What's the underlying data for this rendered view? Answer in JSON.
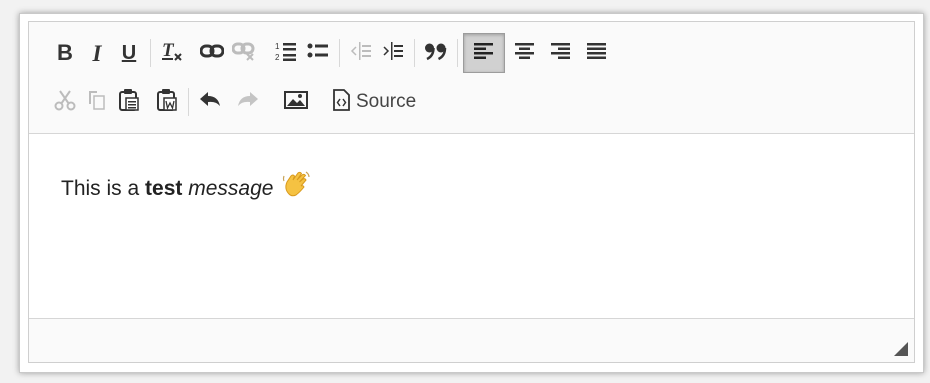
{
  "toolbar": {
    "row1": [
      {
        "name": "bold-button",
        "icon": "bold-icon",
        "text": "B"
      },
      {
        "name": "italic-button",
        "icon": "italic-icon",
        "text": "I"
      },
      {
        "name": "underline-button",
        "icon": "underline-icon",
        "text": "U"
      },
      {
        "name": "remove-format-button",
        "icon": "remove-format-icon",
        "text": "Tx"
      },
      {
        "name": "link-button",
        "icon": "link-icon"
      },
      {
        "name": "unlink-button",
        "icon": "unlink-icon",
        "disabled": true
      },
      {
        "name": "numbered-list-button",
        "icon": "numbered-list-icon"
      },
      {
        "name": "bulleted-list-button",
        "icon": "bulleted-list-icon"
      },
      {
        "name": "outdent-button",
        "icon": "outdent-icon",
        "disabled": true
      },
      {
        "name": "indent-button",
        "icon": "indent-icon"
      },
      {
        "name": "blockquote-button",
        "icon": "blockquote-icon"
      },
      {
        "name": "align-left-button",
        "icon": "align-left-icon",
        "active": true
      },
      {
        "name": "align-center-button",
        "icon": "align-center-icon"
      },
      {
        "name": "align-right-button",
        "icon": "align-right-icon"
      },
      {
        "name": "align-justify-button",
        "icon": "align-justify-icon"
      }
    ],
    "row2": [
      {
        "name": "cut-button",
        "icon": "cut-icon",
        "disabled": true
      },
      {
        "name": "copy-button",
        "icon": "copy-icon",
        "disabled": true
      },
      {
        "name": "paste-button",
        "icon": "paste-icon"
      },
      {
        "name": "paste-from-word-button",
        "icon": "paste-from-word-icon"
      },
      {
        "name": "undo-button",
        "icon": "undo-icon"
      },
      {
        "name": "redo-button",
        "icon": "redo-icon",
        "disabled": true
      },
      {
        "name": "image-button",
        "icon": "image-icon"
      }
    ],
    "source_label": "Source"
  },
  "content": {
    "prefix": "This is a ",
    "bold": "test",
    "italic": "message",
    "emoji": "waving-hand-icon"
  },
  "colors": {
    "active_bg": "#d1d1d1",
    "toolbar_bg": "#fafafa",
    "icon": "#333333",
    "icon_disabled": "#b8b8b8"
  }
}
